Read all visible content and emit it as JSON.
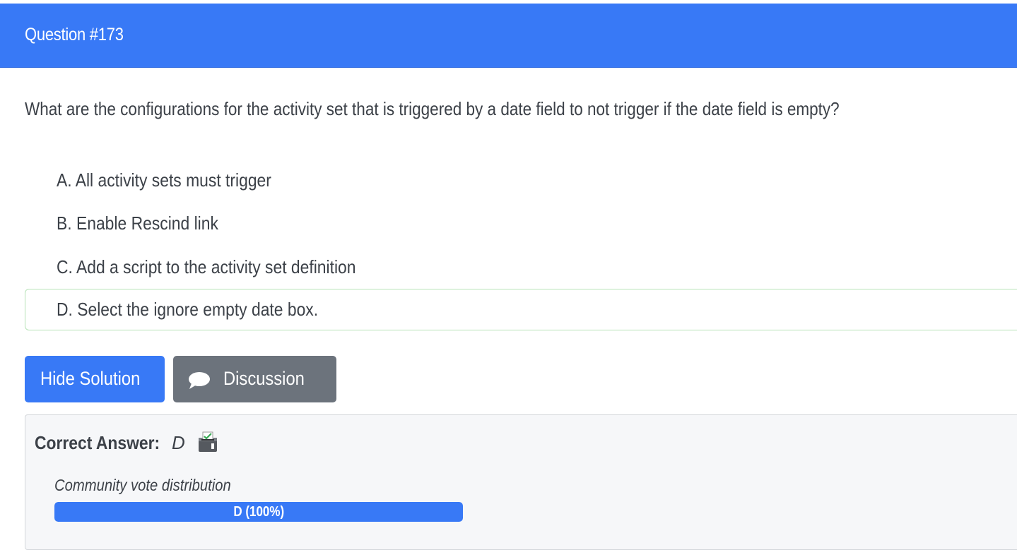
{
  "header": {
    "title": "Question #173",
    "color": "#3879f6"
  },
  "question": {
    "text": "What are the configurations for the activity set that is triggered by a date field to not trigger if the date field is empty?"
  },
  "choices": [
    {
      "label": "A. All activity sets must trigger",
      "correct": false
    },
    {
      "label": "B. Enable Rescind link",
      "correct": false
    },
    {
      "label": "C. Add a script to the activity set definition",
      "correct": false
    },
    {
      "label": "D. Select the ignore empty date box.",
      "correct": true
    }
  ],
  "buttons": {
    "hide_solution": "Hide Solution",
    "discussion": "Discussion",
    "discussion_icon": "comment-icon"
  },
  "solution": {
    "correct_label": "Correct Answer:",
    "correct_value": "D",
    "vote_icon": "ballot-box-icon",
    "vote_caption": "Community vote distribution",
    "vote_bar": {
      "label": "D (100%)",
      "fraction": 1.0
    }
  }
}
